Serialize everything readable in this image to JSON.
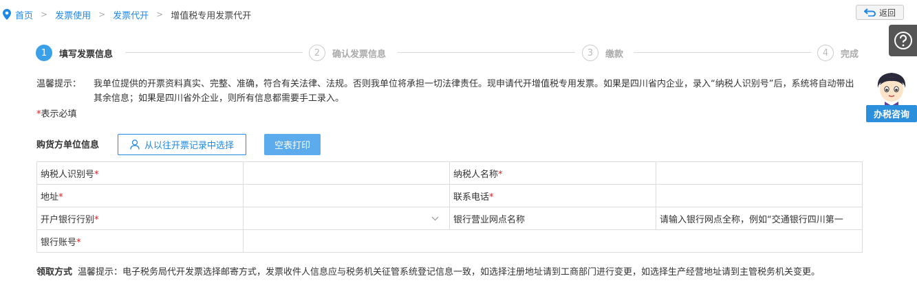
{
  "breadcrumb": {
    "items": [
      "首页",
      "发票使用",
      "发票代开"
    ],
    "current": "增值税专用发票代开",
    "separator": ">"
  },
  "back_button": {
    "label": "返回"
  },
  "consult_button": {
    "label": "办税咨询"
  },
  "steps": [
    {
      "number": "1",
      "label": "填写发票信息",
      "active": true
    },
    {
      "number": "2",
      "label": "确认发票信息",
      "active": false
    },
    {
      "number": "3",
      "label": "缴款",
      "active": false
    },
    {
      "number": "4",
      "label": "完成",
      "active": false
    }
  ],
  "tip": {
    "label": "温馨提示：",
    "text": "我单位提供的开票资料真实、完整、准确，符合有关法律、法规。否则我单位将承担一切法律责任。现申请代开增值税专用发票。如果是四川省内企业，录入“纳税人识别号”后，系统将自动带出其余信息；如果是四川省外企业，则所有信息都需要手工录入。"
  },
  "required_note": {
    "mark": "*",
    "text": "表示必填"
  },
  "buyer": {
    "title": "购货方单位信息",
    "select_history_label": "从以往开票记录中选择",
    "print_label": "空表打印",
    "fields": {
      "taxpayer_id_label": "纳税人识别号",
      "taxpayer_name_label": "纳税人名称",
      "address_label": "地址",
      "phone_label": "联系电话",
      "bank_label": "开户银行行别",
      "branch_label": "银行营业网点名称",
      "branch_placeholder": "请输入银行网点全称，例如“交通银行四川第一",
      "account_label": "银行账号"
    },
    "required_mark": "*"
  },
  "pickup": {
    "label": "领取方式",
    "tip": "温馨提示：电子税务局代开发票选择邮寄方式，发票收件人信息应与税务机关征管系统登记信息一致，如选择注册地址请到工商部门进行变更，如选择生产经营地址请到主管税务机关变更。"
  },
  "colors": {
    "link": "#1e88e5",
    "active_step": "#3aa0e8",
    "required": "#e02020",
    "print_button": "#5cabed",
    "consult_button": "#2b8fdc"
  }
}
